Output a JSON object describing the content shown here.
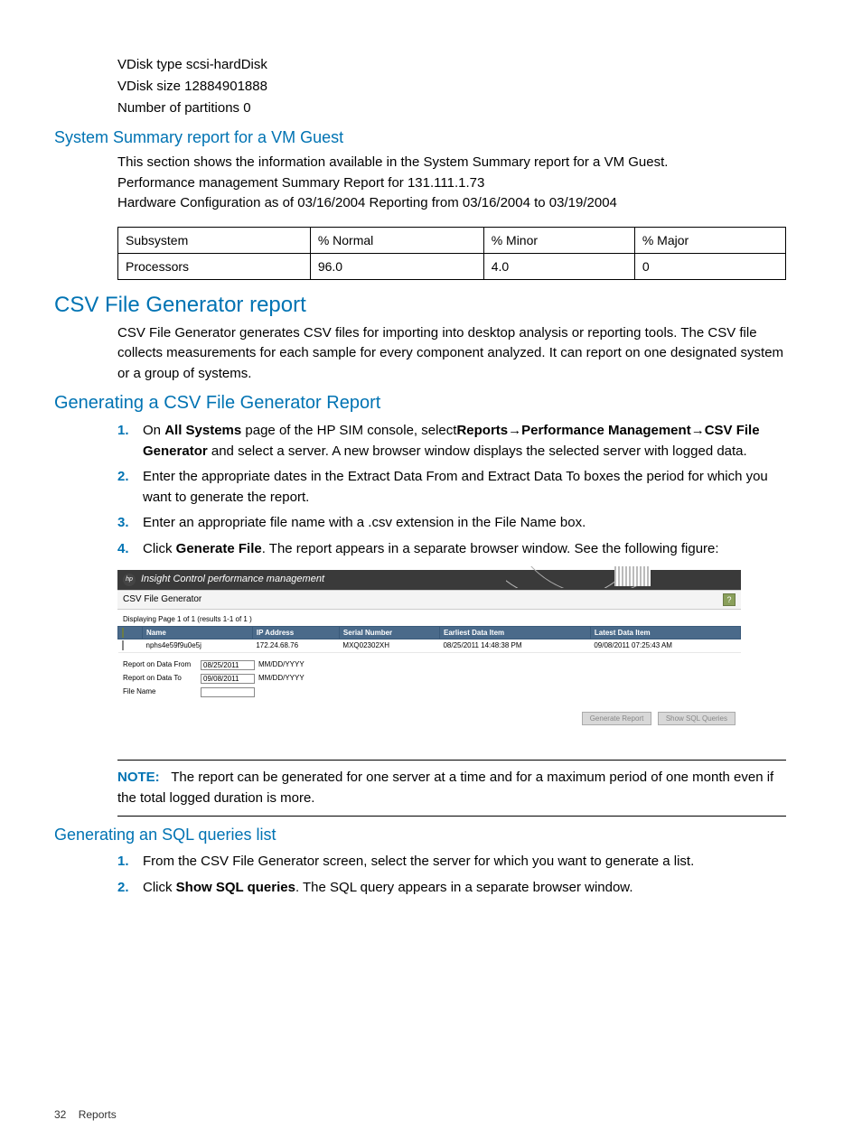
{
  "intro": {
    "line1": "VDisk type scsi-hardDisk",
    "line2": "VDisk size 12884901888",
    "line3": "Number of partitions 0"
  },
  "sys_summary": {
    "heading": "System Summary report for a VM Guest",
    "p1": "This section shows the information available in the System Summary report for a VM Guest.",
    "p2": "Performance management Summary Report for 131.111.1.73",
    "p3": "Hardware Configuration as of 03/16/2004 Reporting from 03/16/2004 to 03/19/2004",
    "table": {
      "headers": [
        "Subsystem",
        "% Normal",
        "% Minor",
        "% Major"
      ],
      "rows": [
        [
          "Processors",
          "96.0",
          "4.0",
          "0"
        ]
      ]
    }
  },
  "csv": {
    "heading": "CSV File Generator report",
    "p1": "CSV File Generator generates CSV files for importing into desktop analysis or reporting tools. The CSV file collects measurements for each sample for every component analyzed. It can report on one designated system or a group of systems.",
    "gen_heading": "Generating a CSV File Generator Report",
    "steps": {
      "s1a": "On ",
      "s1b": "All Systems",
      "s1c": " page of the HP SIM console, select",
      "s1d": "Reports",
      "s1e": "Performance Management",
      "s1f": "CSV File Generator",
      "s1g": " and select a server. A new browser window displays the selected server with logged data.",
      "s2": "Enter the appropriate dates in the Extract Data From and Extract Data To boxes the period for which you want to generate the report.",
      "s3": "Enter an appropriate file name with a .csv extension in the File Name box.",
      "s4a": "Click ",
      "s4b": "Generate File",
      "s4c": ". The report appears in a separate browser window. See the following figure:"
    }
  },
  "figure": {
    "banner_title": "Insight Control performance management",
    "hp_mark": "hp",
    "title": "CSV File Generator",
    "help_mark": "?",
    "displaying": "Displaying Page 1 of 1 (results 1-1 of 1 )",
    "headers": [
      "",
      "Name",
      "IP Address",
      "Serial Number",
      "Earliest Data Item",
      "Latest Data Item"
    ],
    "row": {
      "name": "nphs4e59f9u0e5j",
      "ip": "172.24.68.76",
      "serial": "MXQ02302XH",
      "earliest": "08/25/2011 14:48:38 PM",
      "latest": "09/08/2011 07:25:43 AM"
    },
    "form": {
      "from_label": "Report on Data From",
      "from_value": "08/25/2011",
      "from_fmt": "MM/DD/YYYY",
      "to_label": "Report on Data To",
      "to_value": "09/08/2011",
      "to_fmt": "MM/DD/YYYY",
      "file_label": "File Name",
      "file_value": ""
    },
    "buttons": {
      "generate": "Generate Report",
      "show_sql": "Show SQL Queries"
    }
  },
  "note": {
    "label": "NOTE:",
    "text": "The report can be generated for one server at a time and for a maximum period of one month even if the total logged duration is more."
  },
  "sql": {
    "heading": "Generating an SQL queries list",
    "s1": "From the CSV File Generator screen, select the server for which you want to generate a list.",
    "s2a": "Click ",
    "s2b": "Show SQL queries",
    "s2c": ". The SQL query appears in a separate browser window."
  },
  "footer": {
    "page": "32",
    "label": "Reports"
  },
  "step_nums": {
    "n1": "1.",
    "n2": "2.",
    "n3": "3.",
    "n4": "4."
  }
}
